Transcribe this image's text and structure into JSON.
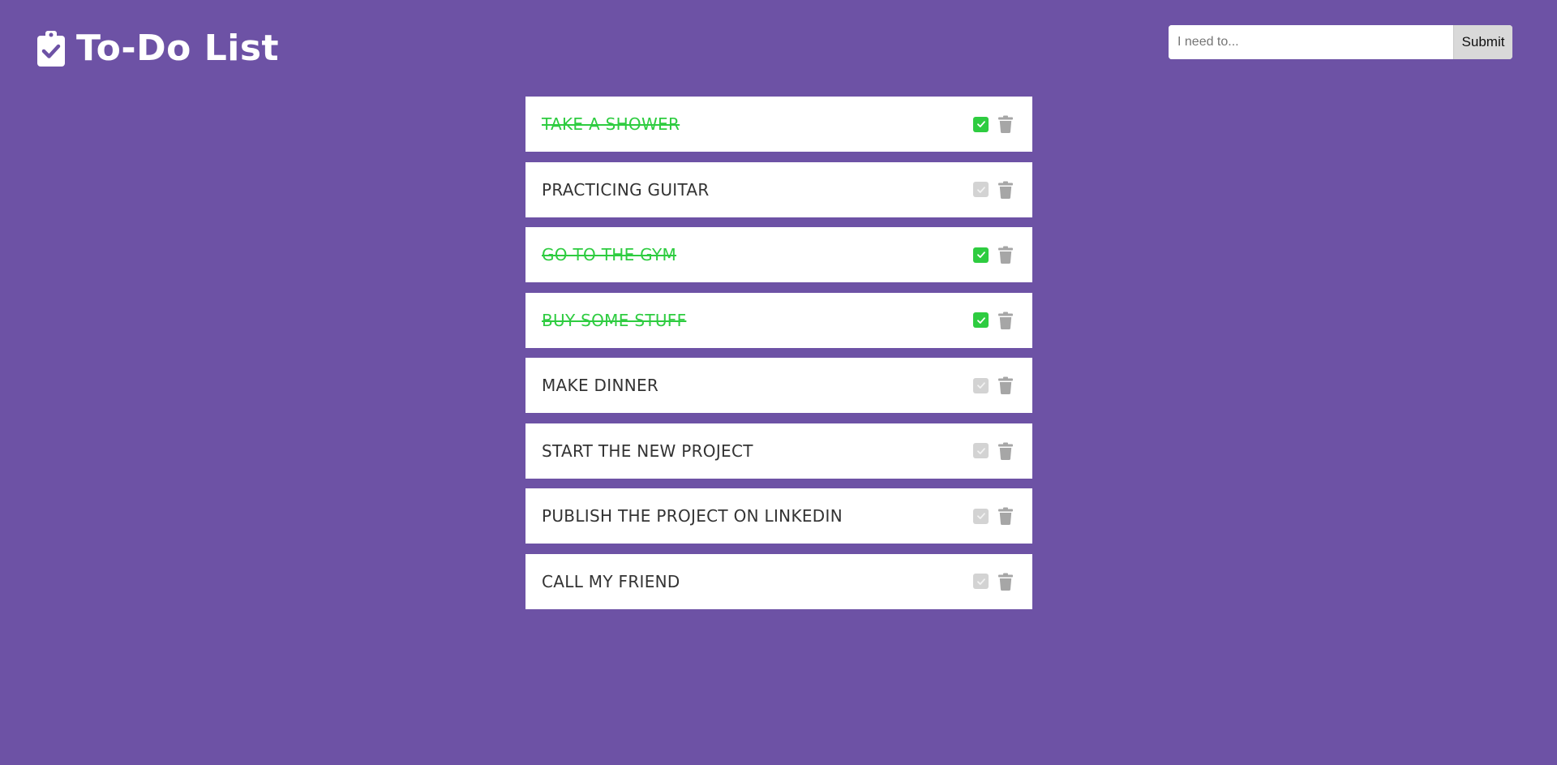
{
  "header": {
    "title": "To-Do List",
    "icon": "clipboard-check-icon"
  },
  "form": {
    "placeholder": "I need to...",
    "value": "",
    "submit_label": "Submit"
  },
  "colors": {
    "background": "#6d52a5",
    "done": "#2ecc40",
    "icon_gray": "#a6a6a6"
  },
  "todos": [
    {
      "text": "TAKE A SHOWER",
      "done": true
    },
    {
      "text": "PRACTICING GUITAR",
      "done": false
    },
    {
      "text": "GO TO THE GYM",
      "done": true
    },
    {
      "text": "BUY SOME STUFF",
      "done": true
    },
    {
      "text": "MAKE DINNER",
      "done": false
    },
    {
      "text": "START THE NEW PROJECT",
      "done": false
    },
    {
      "text": "PUBLISH THE PROJECT ON LINKEDIN",
      "done": false
    },
    {
      "text": "CALL MY FRIEND",
      "done": false
    }
  ]
}
